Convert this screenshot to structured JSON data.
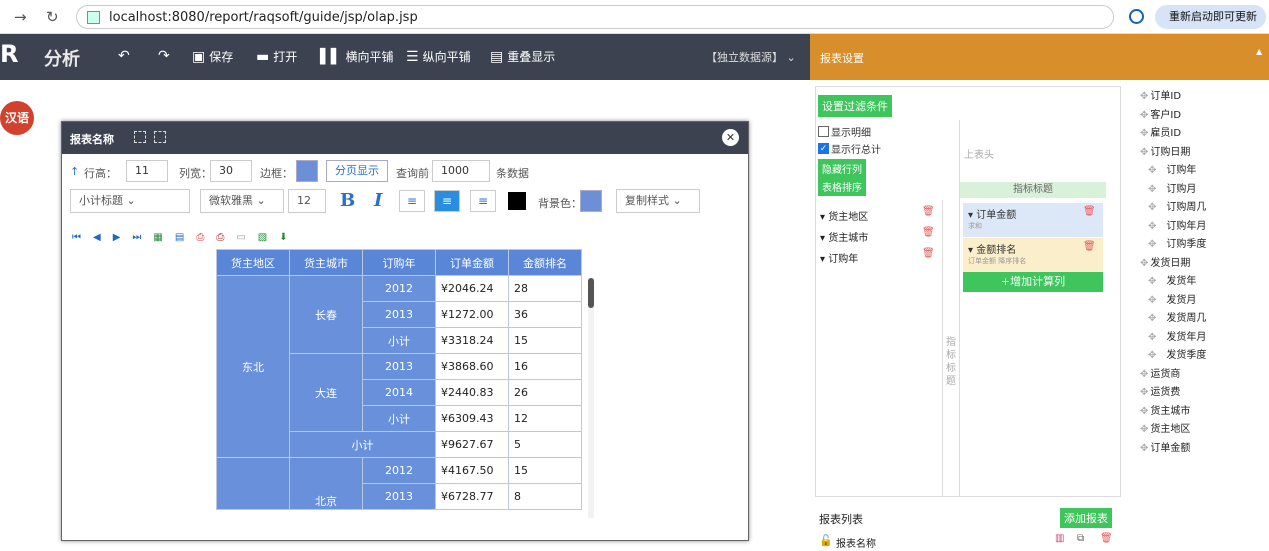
{
  "browser": {
    "url": "localhost:8080/report/raqsoft/guide/jsp/olap.jsp",
    "update_label": "重新启动即可更新"
  },
  "topbar": {
    "logo": "R",
    "title": "分析",
    "save": "保存",
    "open": "打开",
    "htile": "横向平铺",
    "vtile": "纵向平铺",
    "overlap": "重叠显示",
    "datasource": "【独立数据源】"
  },
  "lang_badge": "汉语",
  "panel": {
    "header": "报表设置"
  },
  "window": {
    "title": "报表名称",
    "row_height_label": "行高：",
    "row_height": "11",
    "col_width_label": "列宽：",
    "col_width": "30",
    "border_label": "边框：",
    "paging_label": "分页显示",
    "query_label": "查询前",
    "query_count": "1000",
    "query_suffix": "条数据",
    "subtotal_select": "小计标题",
    "font_select": "微软雅黑",
    "font_size": "12",
    "bg_label": "背景色：",
    "copy_style": "复制样式"
  },
  "table": {
    "headers": [
      "货主地区",
      "货主城市",
      "订购年",
      "订单金额",
      "金额排名"
    ],
    "rows": [
      {
        "year": "2012",
        "amount": "¥2046.24",
        "rank": "28"
      },
      {
        "year": "2013",
        "amount": "¥1272.00",
        "rank": "36"
      },
      {
        "year": "小计",
        "amount": "¥3318.24",
        "rank": "15"
      },
      {
        "year": "2013",
        "amount": "¥3868.60",
        "rank": "16"
      },
      {
        "year": "2014",
        "amount": "¥2440.83",
        "rank": "26"
      },
      {
        "year": "小计",
        "amount": "¥6309.43",
        "rank": "12"
      },
      {
        "year": "小计",
        "amount": "¥9627.67",
        "rank": "5"
      },
      {
        "year": "2012",
        "amount": "¥4167.50",
        "rank": "15"
      },
      {
        "year": "2013",
        "amount": "¥6728.77",
        "rank": "8"
      }
    ],
    "region1": "东北",
    "city1": "长春",
    "city2": "大连",
    "region2_city": "北京"
  },
  "settings": {
    "filter_button": "设置过滤条件",
    "show_detail": "显示明细",
    "show_total": "显示行总计",
    "hide_rows": "隐藏行列",
    "sort": "表格排序",
    "top_header": "上表头",
    "measure_title": "指标标题",
    "side_measure": "指标标题",
    "dims": [
      "货主地区",
      "货主城市",
      "订购年"
    ],
    "measures": [
      {
        "name": "订单金额",
        "sub": "求和"
      },
      {
        "name": "金额排名",
        "sub": "订单金额 降序排名"
      }
    ],
    "add_calc": "+增加计算列"
  },
  "fields": [
    {
      "label": "订单ID",
      "indent": 0
    },
    {
      "label": "客户ID",
      "indent": 0
    },
    {
      "label": "雇员ID",
      "indent": 0
    },
    {
      "label": "订购日期",
      "indent": 0
    },
    {
      "label": "订购年",
      "indent": 1
    },
    {
      "label": "订购月",
      "indent": 1
    },
    {
      "label": "订购周几",
      "indent": 1
    },
    {
      "label": "订购年月",
      "indent": 1
    },
    {
      "label": "订购季度",
      "indent": 1
    },
    {
      "label": "发货日期",
      "indent": 0
    },
    {
      "label": "发货年",
      "indent": 1
    },
    {
      "label": "发货月",
      "indent": 1
    },
    {
      "label": "发货周几",
      "indent": 1
    },
    {
      "label": "发货年月",
      "indent": 1
    },
    {
      "label": "发货季度",
      "indent": 1
    },
    {
      "label": "运货商",
      "indent": 0
    },
    {
      "label": "运货费",
      "indent": 0
    },
    {
      "label": "货主城市",
      "indent": 0
    },
    {
      "label": "货主地区",
      "indent": 0
    },
    {
      "label": "订单金额",
      "indent": 0
    }
  ],
  "reportlist": {
    "title": "报表列表",
    "add": "添加报表",
    "item": "报表名称"
  }
}
